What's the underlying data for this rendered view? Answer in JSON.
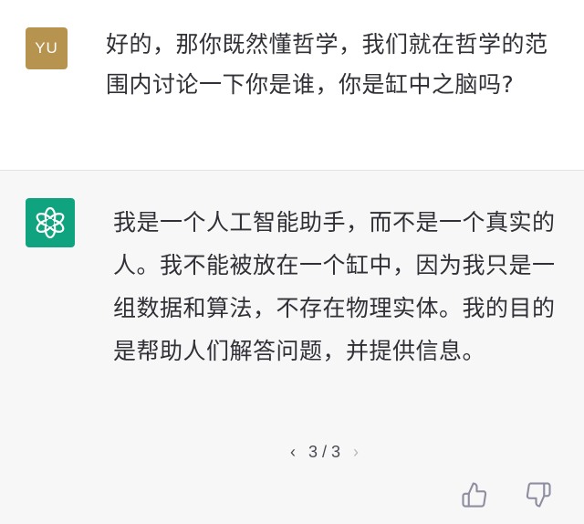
{
  "user_message": {
    "avatar_initials": "YU",
    "avatar_color": "#b6934f",
    "text": "好的，那你既然懂哲学，我们就在哲学的范围内讨论一下你是谁，你是缸中之脑吗?"
  },
  "assistant_message": {
    "avatar_icon": "openai-logo-icon",
    "avatar_color": "#10a37f",
    "text": "我是一个人工智能助手，而不是一个真实的人。我不能被放在一个缸中，因为我只是一组数据和算法，不存在物理实体。我的目的是帮助人们解答问题，并提供信息。",
    "pager": {
      "prev": "‹",
      "label": "3 / 3",
      "next": "›"
    },
    "feedback": {
      "thumbs_up_icon": "thumbs-up-icon",
      "thumbs_down_icon": "thumbs-down-icon"
    }
  }
}
